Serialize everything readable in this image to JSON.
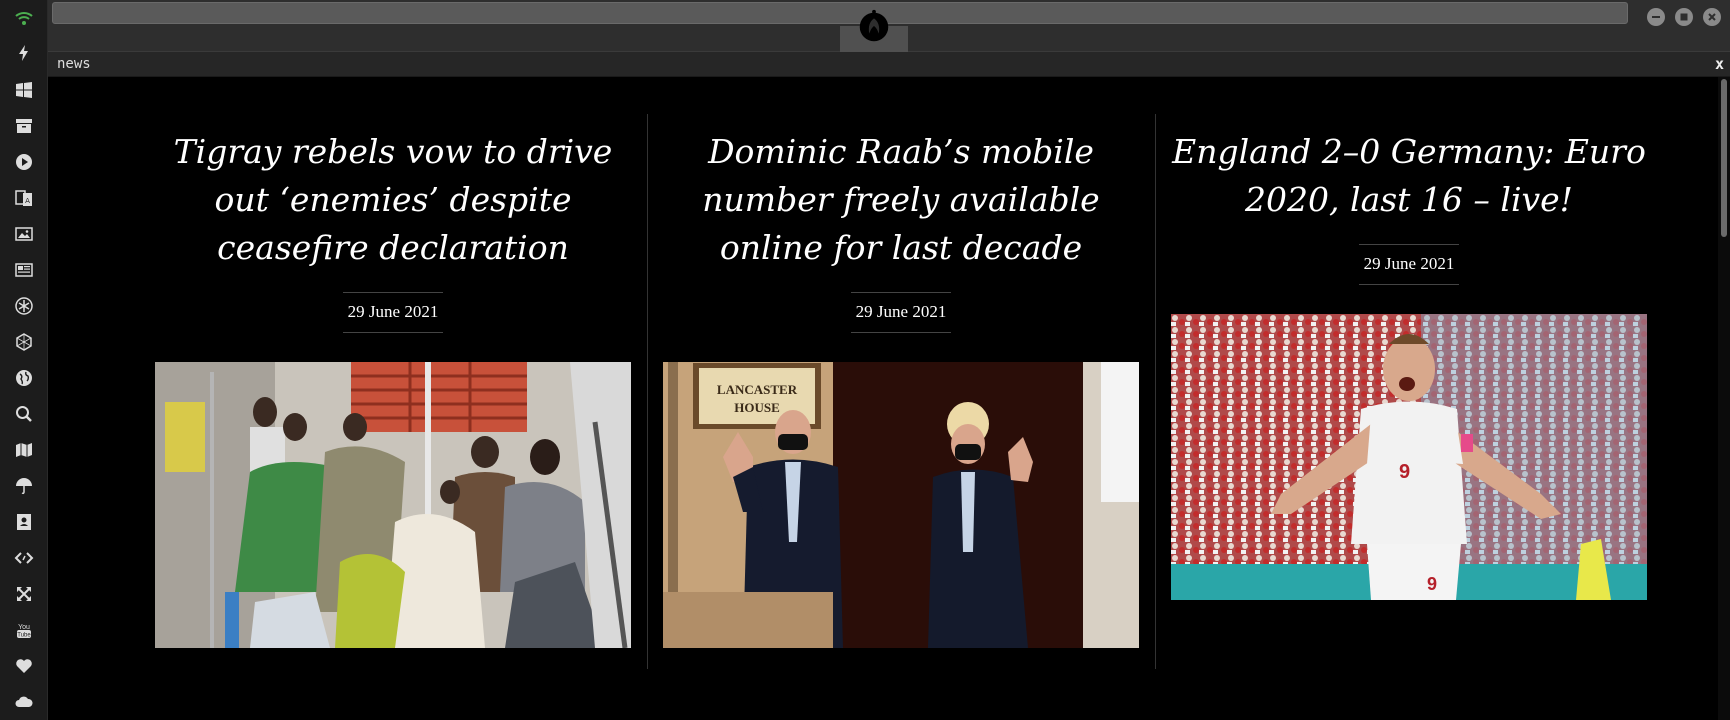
{
  "tab": {
    "title": "news",
    "close": "x"
  },
  "sidebar": {
    "icons": [
      "wifi-icon",
      "bolt-icon",
      "windows-icon",
      "archive-icon",
      "play-icon",
      "translate-icon",
      "image-icon",
      "newspaper-icon",
      "rebel-icon",
      "hexagon-icon",
      "globe-icon",
      "search-icon",
      "map-icon",
      "umbrella-icon",
      "contacts-icon",
      "code-icon",
      "expand-icon",
      "youtube-icon",
      "heart-icon",
      "cloud-icon"
    ],
    "active_color": "#4caf50"
  },
  "articles": [
    {
      "title": "Tigray rebels vow to drive out ‘enemies’ despite ceasefire declaration",
      "date": "29 June 2021",
      "image": "hospital-patients-photo"
    },
    {
      "title": "Dominic Raab’s mobile number freely available online for last decade",
      "date": "29 June 2021",
      "image": "politicians-thumbs-up-photo",
      "sign_text": [
        "LANCASTER",
        "HOUSE"
      ]
    },
    {
      "title": "England 2–0 Germany: Euro 2020, last 16 – live!",
      "date": "29 June 2021",
      "image": "footballer-celebrating-photo",
      "shirt_number": "9"
    }
  ]
}
